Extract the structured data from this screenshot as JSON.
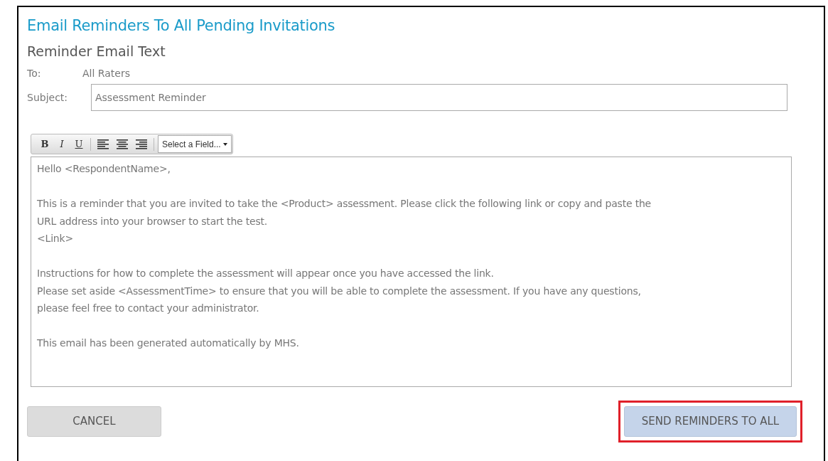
{
  "title": "Email Reminders To All Pending Invitations",
  "subtitle": "Reminder Email Text",
  "to": {
    "label": "To:",
    "value": "All Raters"
  },
  "subject": {
    "label": "Subject:",
    "value": "Assessment Reminder"
  },
  "toolbar": {
    "format_buttons": [
      "B",
      "I",
      "U"
    ],
    "field_select": "Select a Field..."
  },
  "body": [
    [
      "Hello <RespondentName>,"
    ],
    [
      "This is a reminder that you are invited to take the <Product> assessment. Please click the following link or copy and paste the",
      "URL address into your browser to start the test.",
      "<Link>"
    ],
    [
      "Instructions for how to complete the assessment will appear once you have accessed the link.",
      "Please set aside <AssessmentTime> to ensure that you will be able to complete the assessment. If you have any questions,",
      "please feel free to contact your administrator."
    ],
    [
      "This email has been generated automatically by MHS."
    ]
  ],
  "buttons": {
    "cancel": "CANCEL",
    "send": "SEND REMINDERS TO ALL"
  },
  "highlight": {
    "highlighted": true
  }
}
